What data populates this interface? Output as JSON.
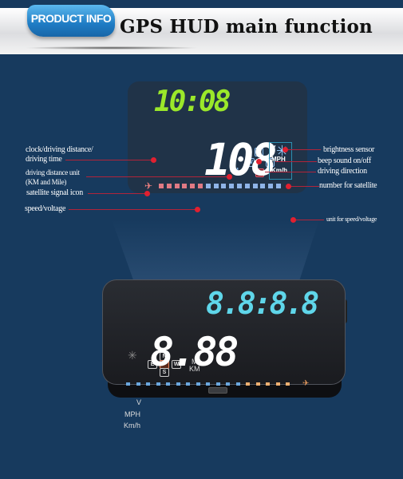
{
  "banner": {
    "badge": "PRODUCT INFO",
    "title": "GPS HUD main  function"
  },
  "annotations": {
    "left": [
      {
        "id": "clock",
        "lines": [
          "clock/driving distance/",
          "driving time"
        ]
      },
      {
        "id": "distance-unit",
        "lines": [
          "driving distance unit",
          "(KM and Mile)"
        ]
      },
      {
        "id": "satellite-icon",
        "lines": [
          "satellite signal icon"
        ]
      },
      {
        "id": "speed",
        "lines": [
          "speed/voltage"
        ]
      }
    ],
    "right": [
      {
        "id": "brightness",
        "text": "brightness sensor"
      },
      {
        "id": "beep",
        "text": "beep sound on/off"
      },
      {
        "id": "direction",
        "text": "driving direction"
      },
      {
        "id": "satellite-number",
        "text": "number for satellite"
      },
      {
        "id": "speed-unit",
        "text": "unit for speed/voltage"
      }
    ]
  },
  "projection": {
    "clock_value": "10:08",
    "distance_units": [
      "M",
      "KM"
    ],
    "compass": [
      "N",
      "W",
      "E"
    ],
    "speed_value": "108",
    "speed_units": [
      "V",
      "MPH",
      "Km/h"
    ],
    "satellite_bars_red": 6,
    "satellite_bars_blue": 10
  },
  "device": {
    "clock_value": "8.8:8.8",
    "distance_units": [
      "M",
      "KM"
    ],
    "compass": [
      "N",
      "E",
      "W",
      "S"
    ],
    "speed_value": "8.88",
    "speed_units": [
      "V",
      "MPH",
      "Km/h"
    ],
    "satellite_bars_blue": 12,
    "satellite_bars_orange": 5
  },
  "colors": {
    "background": "#173a5e",
    "clock_green": "#9be82a",
    "device_cyan": "#5fd6ea",
    "leader_red": "#e02030"
  }
}
